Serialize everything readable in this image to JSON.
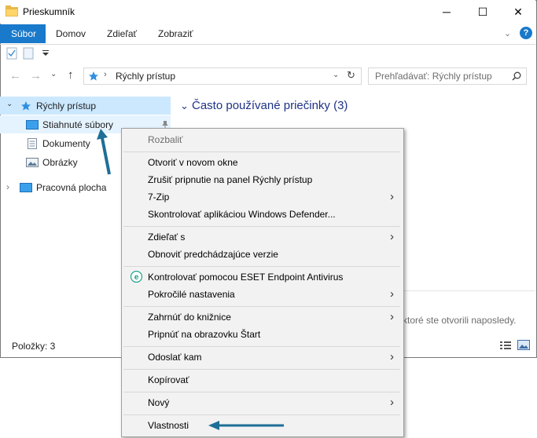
{
  "window": {
    "title": "Prieskumník",
    "controls": {
      "minimize": "─",
      "maximize": "☐",
      "close": "✕"
    }
  },
  "ribbon": {
    "tabs": [
      "Súbor",
      "Domov",
      "Zdieľať",
      "Zobraziť"
    ],
    "help": "?"
  },
  "address": {
    "path": "Rýchly prístup",
    "search_placeholder": "Prehľadávať: Rýchly prístup"
  },
  "nav": {
    "quick_access": "Rýchly prístup",
    "downloads": "Stiahnuté súbory",
    "documents": "Dokumenty",
    "pictures": "Obrázky",
    "desktop": "Pracovná plocha"
  },
  "content": {
    "frequent_header": "Často používané priečinky (3)",
    "recent_tail": "ktoré ste otvorili naposledy."
  },
  "status": {
    "items": "Položky: 3"
  },
  "context_menu": {
    "expand": "Rozbaliť",
    "open_new_window": "Otvoriť v novom okne",
    "unpin": "Zrušiť pripnutie na panel Rýchly prístup",
    "seven_zip": "7-Zip",
    "defender": "Skontrolovať aplikáciou Windows Defender...",
    "share_with": "Zdieľať s",
    "restore_versions": "Obnoviť predchádzajúce verzie",
    "eset": "Kontrolovať pomocou ESET Endpoint Antivirus",
    "advanced": "Pokročilé nastavenia",
    "include_library": "Zahrnúť do knižnice",
    "pin_start": "Pripnúť na obrazovku Štart",
    "send_to": "Odoslať kam",
    "copy": "Kopírovať",
    "new": "Nový",
    "properties": "Vlastnosti"
  },
  "colors": {
    "accent": "#1979ca",
    "selection": "#cce8ff",
    "arrow": "#1e6f96",
    "header_text": "#1e3287"
  }
}
